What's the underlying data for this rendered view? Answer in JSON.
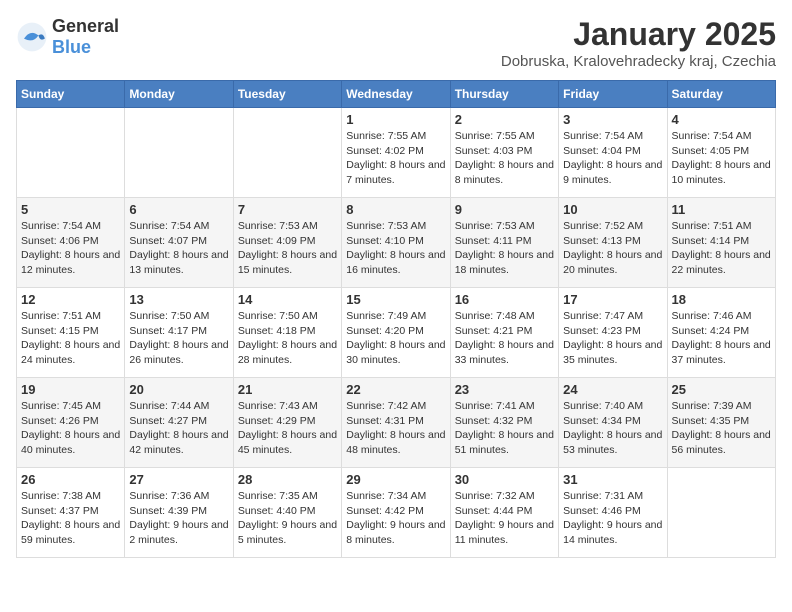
{
  "header": {
    "logo_general": "General",
    "logo_blue": "Blue",
    "month_title": "January 2025",
    "location": "Dobruska, Kralovehradecky kraj, Czechia"
  },
  "weekdays": [
    "Sunday",
    "Monday",
    "Tuesday",
    "Wednesday",
    "Thursday",
    "Friday",
    "Saturday"
  ],
  "weeks": [
    [
      {
        "day": "",
        "info": ""
      },
      {
        "day": "",
        "info": ""
      },
      {
        "day": "",
        "info": ""
      },
      {
        "day": "1",
        "info": "Sunrise: 7:55 AM\nSunset: 4:02 PM\nDaylight: 8 hours\nand 7 minutes."
      },
      {
        "day": "2",
        "info": "Sunrise: 7:55 AM\nSunset: 4:03 PM\nDaylight: 8 hours\nand 8 minutes."
      },
      {
        "day": "3",
        "info": "Sunrise: 7:54 AM\nSunset: 4:04 PM\nDaylight: 8 hours\nand 9 minutes."
      },
      {
        "day": "4",
        "info": "Sunrise: 7:54 AM\nSunset: 4:05 PM\nDaylight: 8 hours\nand 10 minutes."
      }
    ],
    [
      {
        "day": "5",
        "info": "Sunrise: 7:54 AM\nSunset: 4:06 PM\nDaylight: 8 hours\nand 12 minutes."
      },
      {
        "day": "6",
        "info": "Sunrise: 7:54 AM\nSunset: 4:07 PM\nDaylight: 8 hours\nand 13 minutes."
      },
      {
        "day": "7",
        "info": "Sunrise: 7:53 AM\nSunset: 4:09 PM\nDaylight: 8 hours\nand 15 minutes."
      },
      {
        "day": "8",
        "info": "Sunrise: 7:53 AM\nSunset: 4:10 PM\nDaylight: 8 hours\nand 16 minutes."
      },
      {
        "day": "9",
        "info": "Sunrise: 7:53 AM\nSunset: 4:11 PM\nDaylight: 8 hours\nand 18 minutes."
      },
      {
        "day": "10",
        "info": "Sunrise: 7:52 AM\nSunset: 4:13 PM\nDaylight: 8 hours\nand 20 minutes."
      },
      {
        "day": "11",
        "info": "Sunrise: 7:51 AM\nSunset: 4:14 PM\nDaylight: 8 hours\nand 22 minutes."
      }
    ],
    [
      {
        "day": "12",
        "info": "Sunrise: 7:51 AM\nSunset: 4:15 PM\nDaylight: 8 hours\nand 24 minutes."
      },
      {
        "day": "13",
        "info": "Sunrise: 7:50 AM\nSunset: 4:17 PM\nDaylight: 8 hours\nand 26 minutes."
      },
      {
        "day": "14",
        "info": "Sunrise: 7:50 AM\nSunset: 4:18 PM\nDaylight: 8 hours\nand 28 minutes."
      },
      {
        "day": "15",
        "info": "Sunrise: 7:49 AM\nSunset: 4:20 PM\nDaylight: 8 hours\nand 30 minutes."
      },
      {
        "day": "16",
        "info": "Sunrise: 7:48 AM\nSunset: 4:21 PM\nDaylight: 8 hours\nand 33 minutes."
      },
      {
        "day": "17",
        "info": "Sunrise: 7:47 AM\nSunset: 4:23 PM\nDaylight: 8 hours\nand 35 minutes."
      },
      {
        "day": "18",
        "info": "Sunrise: 7:46 AM\nSunset: 4:24 PM\nDaylight: 8 hours\nand 37 minutes."
      }
    ],
    [
      {
        "day": "19",
        "info": "Sunrise: 7:45 AM\nSunset: 4:26 PM\nDaylight: 8 hours\nand 40 minutes."
      },
      {
        "day": "20",
        "info": "Sunrise: 7:44 AM\nSunset: 4:27 PM\nDaylight: 8 hours\nand 42 minutes."
      },
      {
        "day": "21",
        "info": "Sunrise: 7:43 AM\nSunset: 4:29 PM\nDaylight: 8 hours\nand 45 minutes."
      },
      {
        "day": "22",
        "info": "Sunrise: 7:42 AM\nSunset: 4:31 PM\nDaylight: 8 hours\nand 48 minutes."
      },
      {
        "day": "23",
        "info": "Sunrise: 7:41 AM\nSunset: 4:32 PM\nDaylight: 8 hours\nand 51 minutes."
      },
      {
        "day": "24",
        "info": "Sunrise: 7:40 AM\nSunset: 4:34 PM\nDaylight: 8 hours\nand 53 minutes."
      },
      {
        "day": "25",
        "info": "Sunrise: 7:39 AM\nSunset: 4:35 PM\nDaylight: 8 hours\nand 56 minutes."
      }
    ],
    [
      {
        "day": "26",
        "info": "Sunrise: 7:38 AM\nSunset: 4:37 PM\nDaylight: 8 hours\nand 59 minutes."
      },
      {
        "day": "27",
        "info": "Sunrise: 7:36 AM\nSunset: 4:39 PM\nDaylight: 9 hours\nand 2 minutes."
      },
      {
        "day": "28",
        "info": "Sunrise: 7:35 AM\nSunset: 4:40 PM\nDaylight: 9 hours\nand 5 minutes."
      },
      {
        "day": "29",
        "info": "Sunrise: 7:34 AM\nSunset: 4:42 PM\nDaylight: 9 hours\nand 8 minutes."
      },
      {
        "day": "30",
        "info": "Sunrise: 7:32 AM\nSunset: 4:44 PM\nDaylight: 9 hours\nand 11 minutes."
      },
      {
        "day": "31",
        "info": "Sunrise: 7:31 AM\nSunset: 4:46 PM\nDaylight: 9 hours\nand 14 minutes."
      },
      {
        "day": "",
        "info": ""
      }
    ]
  ]
}
